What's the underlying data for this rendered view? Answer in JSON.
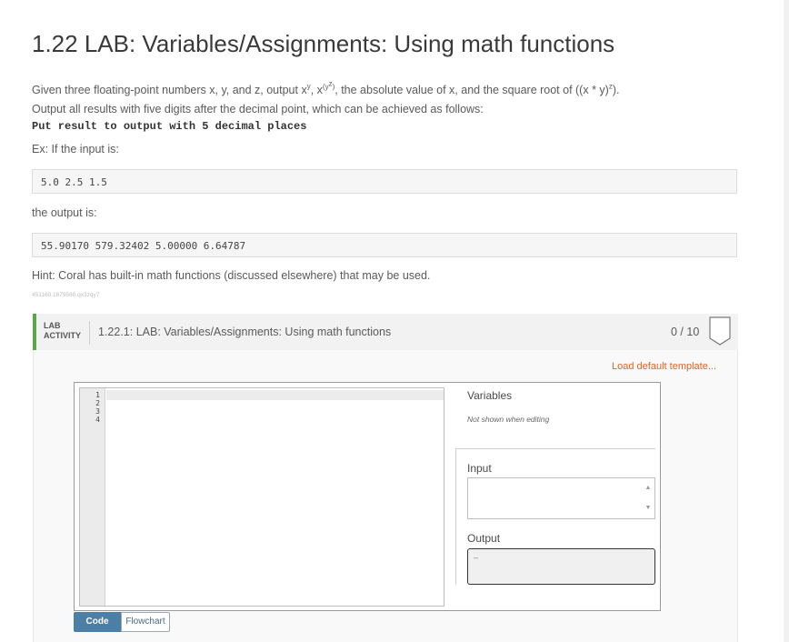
{
  "page": {
    "title": "1.22 LAB: Variables/Assignments: Using math functions",
    "desc_parts": {
      "a": "Given three floating-point numbers x, y, and z, output x",
      "s1": "y",
      "b": ", x",
      "s2": "(y",
      "s3": "z",
      "s4": ")",
      "c": ", the absolute value of x, and the square root of ((x * y)",
      "s5": "z",
      "d": ")."
    },
    "format_text": "Output all results with five digits after the decimal point, which can be achieved as follows:",
    "format_code": "Put result to output with 5 decimal places",
    "input_label": "Ex: If the input is:",
    "input_example": "5.0 2.5 1.5",
    "output_label": "the output is:",
    "output_example": "55.90170 579.32402 5.00000 6.64787",
    "hint": "Hint: Coral has built-in math functions (discussed elsewhere) that may be used.",
    "tiny_id": "451160.1679580.qx3zqy7"
  },
  "lab": {
    "tag_line1": "LAB",
    "tag_line2": "ACTIVITY",
    "name": "1.22.1: LAB: Variables/Assignments: Using math functions",
    "score": "0 / 10",
    "load_template": "Load default template...",
    "line_numbers": [
      "1",
      "2",
      "3",
      "4"
    ],
    "variables_label": "Variables",
    "variables_note": "Not shown when editing",
    "input_label": "Input",
    "output_label": "Output",
    "output_value": "–",
    "tabs": {
      "code": "Code",
      "flowchart": "Flowchart"
    }
  },
  "colors": {
    "accent_green": "#5aa64a",
    "link_orange": "#d9642a",
    "tab_blue": "#4d7ea5"
  }
}
